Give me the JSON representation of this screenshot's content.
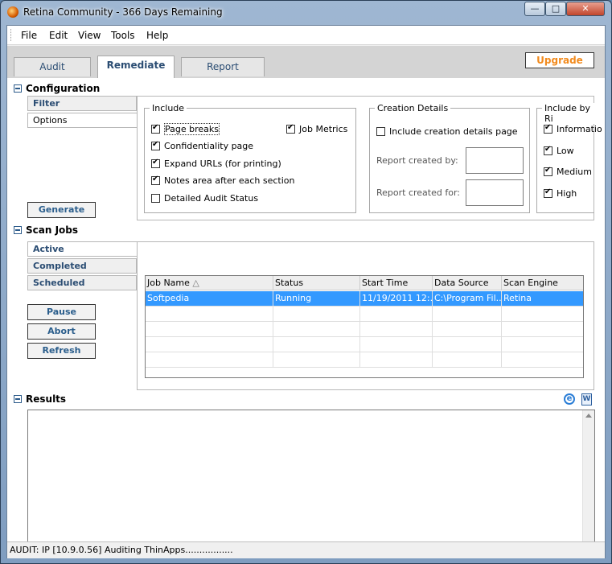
{
  "window": {
    "title": "Retina Community - 366  Days Remaining",
    "min": "—",
    "max": "□",
    "close": "✕"
  },
  "menu": {
    "file": "File",
    "edit": "Edit",
    "view": "View",
    "tools": "Tools",
    "help": "Help"
  },
  "tabs": {
    "audit": "Audit",
    "remediate": "Remediate",
    "report": "Report",
    "upgrade": "Upgrade"
  },
  "configuration": {
    "title": "Configuration",
    "side_tabs": {
      "filter": "Filter",
      "options": "Options"
    },
    "generate": "Generate",
    "include": {
      "title": "Include",
      "page_breaks": "Page breaks",
      "confidentiality_page": "Confidentiality page",
      "expand_urls": "Expand URLs (for printing)",
      "notes_area": "Notes area after each section",
      "detailed_audit_status": "Detailed Audit Status",
      "job_metrics": "Job Metrics"
    },
    "creation_details": {
      "title": "Creation Details",
      "include_page": "Include creation details page",
      "created_by": "Report created by:",
      "created_for": "Report created for:"
    },
    "include_by_risk": {
      "title": "Include by Ri",
      "information": "Informatio",
      "low": "Low",
      "medium": "Medium",
      "high": "High"
    }
  },
  "scan_jobs": {
    "title": "Scan Jobs",
    "side_tabs": {
      "active": "Active",
      "completed": "Completed",
      "scheduled": "Scheduled"
    },
    "buttons": {
      "pause": "Pause",
      "abort": "Abort",
      "refresh": "Refresh"
    },
    "columns": {
      "job_name": "Job Name",
      "sort_glyph": "△",
      "status": "Status",
      "start_time": "Start Time",
      "data_source": "Data Source",
      "scan_engine": "Scan Engine"
    },
    "rows": [
      {
        "job_name": "Softpedia",
        "status": "Running",
        "start_time": "11/19/2011 12:...",
        "data_source": "C:\\Program Fil...",
        "scan_engine": "Retina"
      }
    ]
  },
  "results": {
    "title": "Results",
    "ie_icon": "e",
    "word_icon": "W"
  },
  "status": {
    "text": "AUDIT: IP [10.9.0.56] Auditing ThinApps................."
  }
}
